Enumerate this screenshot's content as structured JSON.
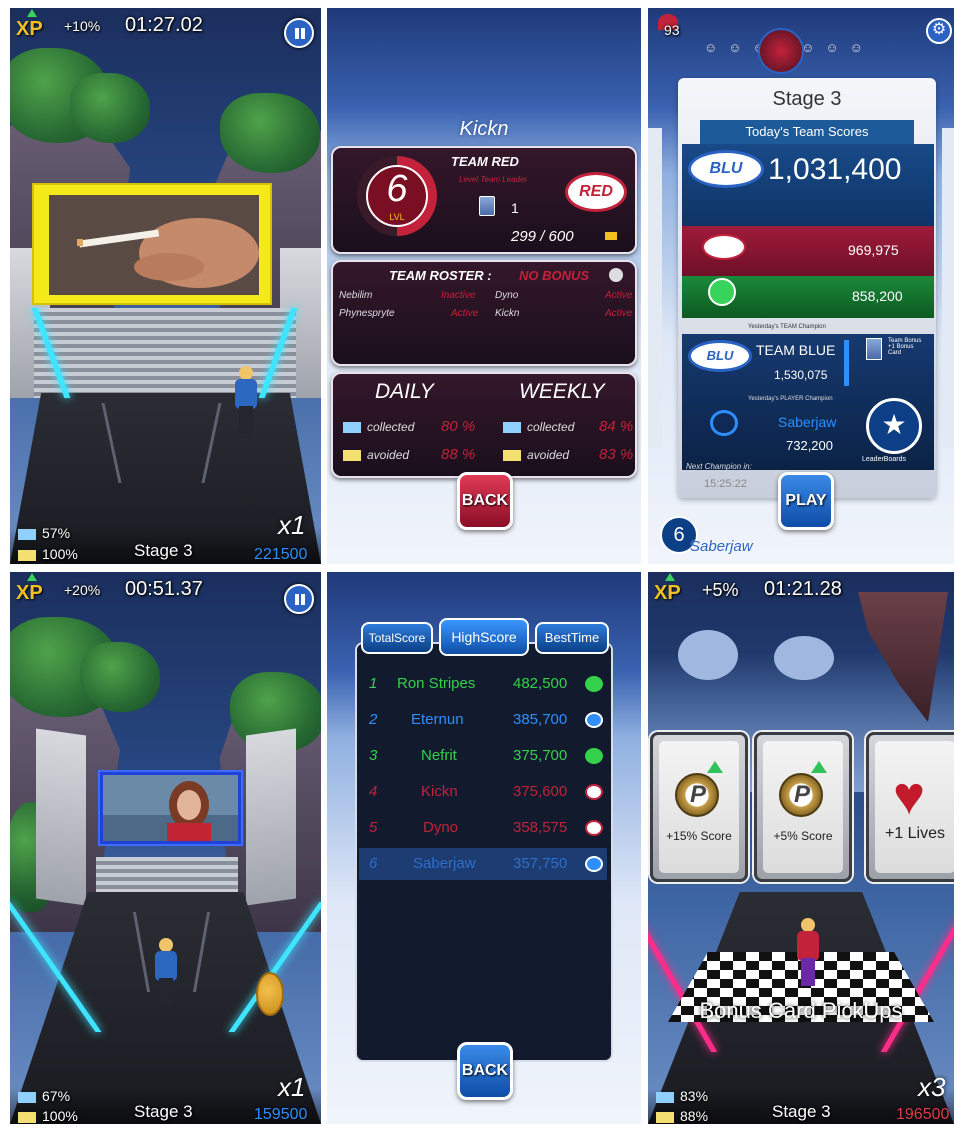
{
  "colors": {
    "accent_blue": "#2f8fff",
    "team_red": "#c2223a",
    "neon": "#3fe4ff",
    "xp_gold": "#f0c020"
  },
  "run1": {
    "xp_icon": "xp-icon",
    "xp_bonus": "+10%",
    "timer": "01:27.02",
    "collected_pct": "57%",
    "avoided_pct": "100%",
    "stage": "Stage 3",
    "multiplier": "x1",
    "score": "221500"
  },
  "profile": {
    "player_name": "Kickn",
    "level": "6",
    "level_label": "LVL",
    "team_label": "TEAM RED",
    "team_subtitle": "Level Team Leader",
    "cards": "1",
    "xp_progress": "299  /  600",
    "roster_title": "TEAM ROSTER :",
    "roster_bonus": "NO BONUS",
    "roster": [
      {
        "name": "Nebilim",
        "status": "Inactive"
      },
      {
        "name": "Dyno",
        "status": "Active"
      },
      {
        "name": "Phynesprytе",
        "status": "Active"
      },
      {
        "name": "Kickn",
        "status": "Active"
      }
    ],
    "daily_label": "DAILY",
    "weekly_label": "WEEKLY",
    "daily_collected": "80 %",
    "daily_avoided": "88 %",
    "weekly_collected": "84 %",
    "weekly_avoided": "83 %",
    "collected_label": "collected",
    "avoided_label": "avoided",
    "back": "BACK"
  },
  "team": {
    "hearts": "93",
    "stage": "Stage 3",
    "today_label": "Today's Team Scores",
    "blue_logo": "BLU",
    "blue_score": "1,031,400",
    "red_score": "969,975",
    "green_score": "858,200",
    "team_champion_label": "Yesterday's TEAM Champion",
    "champion_team": "TEAM BLUE",
    "champion_score": "1,530,075",
    "bonus_label": "Team Bonus +1 Bonus Card",
    "player_champion_label": "Yesterday's PLAYER Champion",
    "champion_player": "Saberjaw",
    "champion_player_score": "732,200",
    "next_label": "Next Champion in:",
    "countdown": "15:25:22",
    "leaderboards": "LeaderBoards",
    "play": "PLAY",
    "profile_level": "6",
    "profile_name": "Saberjaw"
  },
  "run2": {
    "xp_bonus": "+20%",
    "timer": "00:51.37",
    "collected_pct": "67%",
    "avoided_pct": "100%",
    "stage": "Stage 3",
    "multiplier": "x1",
    "score": "159500"
  },
  "leaderboard": {
    "tabs": [
      "TotalScore",
      "HighScore",
      "BestTime"
    ],
    "rows": [
      {
        "rank": "1",
        "name": "Ron Stripes",
        "score": "482,500",
        "team": "green"
      },
      {
        "rank": "2",
        "name": "Eternun",
        "score": "385,700",
        "team": "blue"
      },
      {
        "rank": "3",
        "name": "Nefrit",
        "score": "375,700",
        "team": "green"
      },
      {
        "rank": "4",
        "name": "Kickn",
        "score": "375,600",
        "team": "red"
      },
      {
        "rank": "5",
        "name": "Dyno",
        "score": "358,575",
        "team": "red"
      },
      {
        "rank": "6",
        "name": "Saberjaw",
        "score": "357,750",
        "team": "blue"
      }
    ],
    "back": "BACK"
  },
  "bonus": {
    "xp_bonus": "+5%",
    "timer": "01:21.28",
    "cards": [
      "+15% Score",
      "+5% Score",
      "+1 Lives"
    ],
    "title": "Bonus Card PickUps",
    "collected_pct": "83%",
    "avoided_pct": "88%",
    "stage": "Stage 3",
    "multiplier": "x3",
    "score": "196500"
  }
}
